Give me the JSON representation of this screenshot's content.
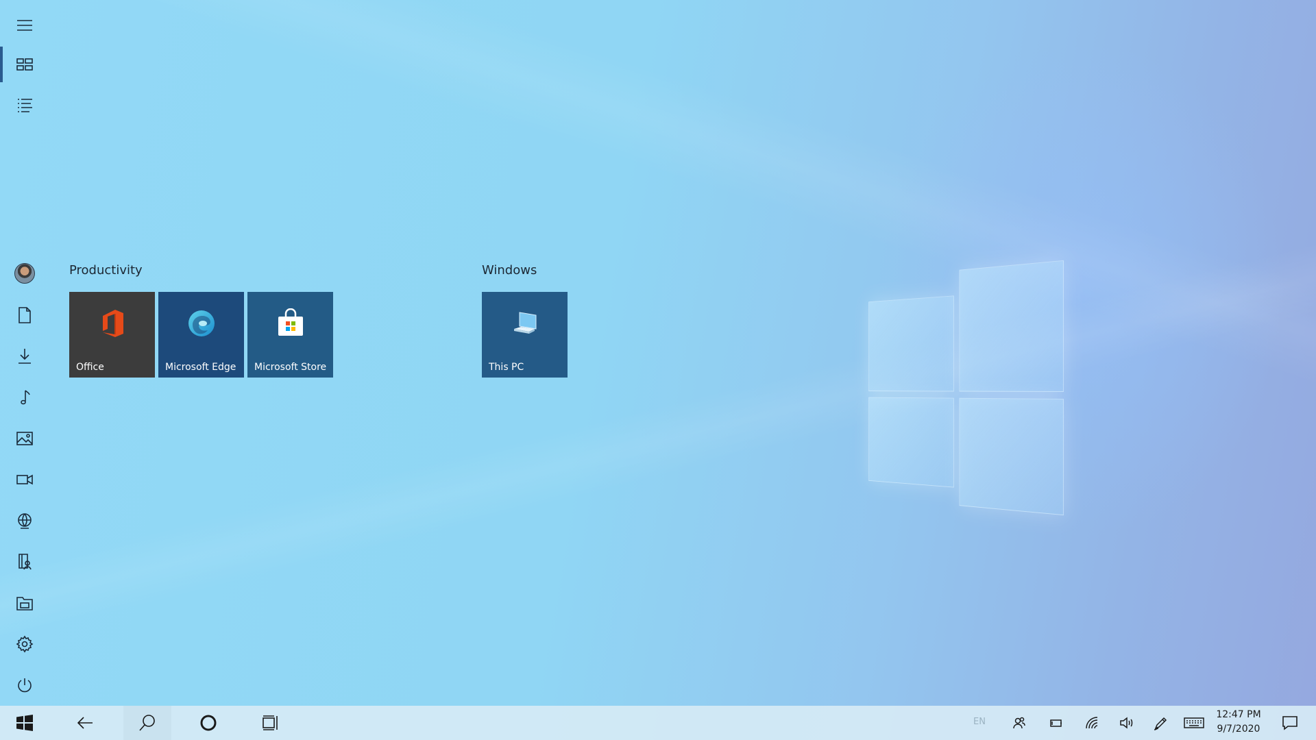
{
  "colors": {
    "office_tile": "#3c3c3c",
    "edge_tile": "#1d4a7b",
    "store_tile": "#235b86",
    "thispc_tile": "#245a87",
    "rail_selection": "#2a5b8f"
  },
  "rail": {
    "top_items": [
      {
        "name": "menu-icon",
        "selected": false
      },
      {
        "name": "tiles-view-icon",
        "selected": true
      },
      {
        "name": "all-apps-list-icon",
        "selected": false
      }
    ],
    "bottom_items": [
      "avatar",
      "documents-icon",
      "downloads-icon",
      "music-icon",
      "pictures-icon",
      "videos-icon",
      "network-icon",
      "personal-folder-icon",
      "file-explorer-icon",
      "settings-icon",
      "power-icon"
    ]
  },
  "groups": [
    {
      "title": "Productivity",
      "tiles": [
        {
          "label": "Office",
          "icon": "office-icon"
        },
        {
          "label": "Microsoft Edge",
          "icon": "edge-icon"
        },
        {
          "label": "Microsoft Store",
          "icon": "store-icon"
        }
      ]
    },
    {
      "title": "Windows",
      "tiles": [
        {
          "label": "This PC",
          "icon": "this-pc-icon"
        }
      ]
    }
  ],
  "taskbar": {
    "buttons": [
      "start-icon",
      "back-icon",
      "search-icon",
      "cortana-icon",
      "task-view-icon"
    ],
    "tray": {
      "language": "EN",
      "icons": [
        "people-icon",
        "battery-icon",
        "wifi-icon",
        "volume-icon",
        "pen-icon",
        "touch-keyboard-icon"
      ]
    },
    "clock": {
      "time": "12:47 PM",
      "date": "9/7/2020"
    },
    "notification_icon": "action-center-icon"
  }
}
